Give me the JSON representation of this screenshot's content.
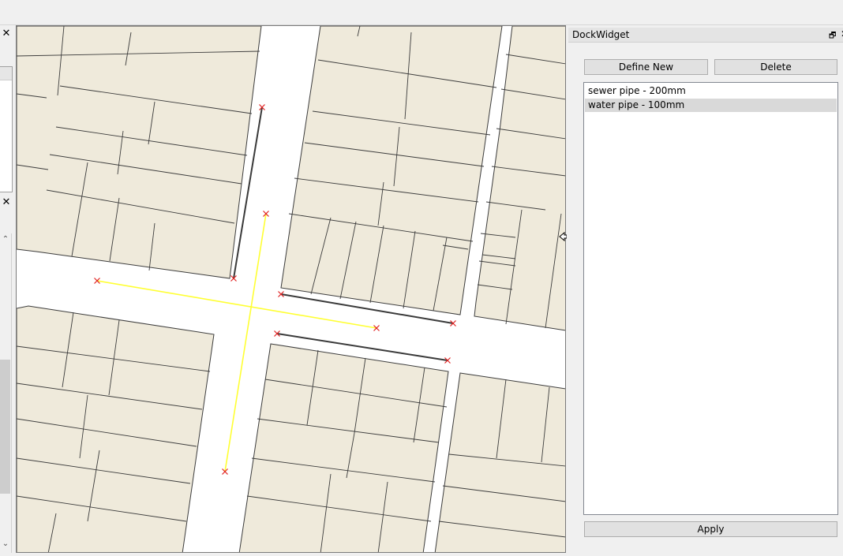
{
  "left_dock": {
    "close_top": "✕",
    "close_mid": "✕",
    "scroll_up": "⌃",
    "scroll_down": "⌄"
  },
  "map": {
    "background": "#ffffff",
    "parcel_fill": "#efeadb",
    "parcel_stroke": "#3c3c3c",
    "sewer_color": "#3a3a3a",
    "water_color": "#ffff33",
    "vertex_color": "#e02020"
  },
  "dock": {
    "title": "DockWidget",
    "float_icon": "🗗",
    "close_icon": "✕",
    "define_new_label": "Define New",
    "delete_label": "Delete",
    "apply_label": "Apply",
    "items": [
      {
        "label": "sewer pipe - 200mm",
        "selected": false
      },
      {
        "label": "water pipe - 100mm",
        "selected": true
      }
    ]
  }
}
